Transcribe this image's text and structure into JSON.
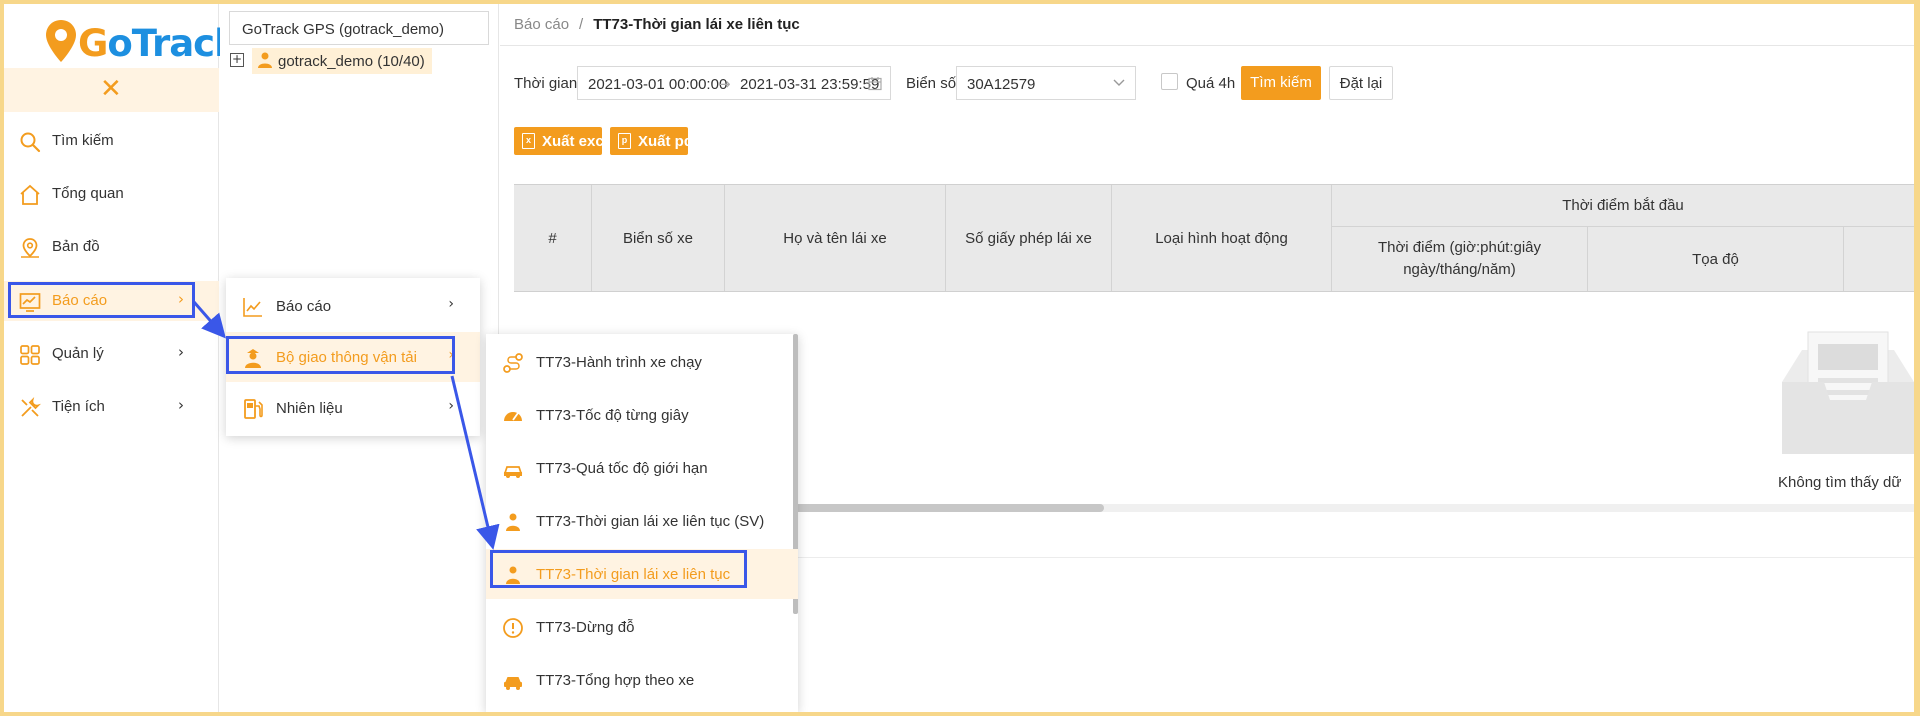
{
  "app": {
    "logo_prefix": "G",
    "logo_rest": "oTrack"
  },
  "sidebar": {
    "collapse_icon": "close-x",
    "items": [
      {
        "label": "Tìm kiếm",
        "icon": "search-icon"
      },
      {
        "label": "Tổng quan",
        "icon": "home-icon"
      },
      {
        "label": "Bản đồ",
        "icon": "map-pin-icon"
      },
      {
        "label": "Báo cáo",
        "icon": "chart-icon",
        "active": true
      },
      {
        "label": "Quản lý",
        "icon": "grid-icon"
      },
      {
        "label": "Tiện ích",
        "icon": "tools-icon"
      }
    ]
  },
  "tree": {
    "account": "GoTrack GPS (gotrack_demo)",
    "node_label": "gotrack_demo (10/40)"
  },
  "breadcrumb": {
    "root": "Báo cáo",
    "sep": "/",
    "current": "TT73-Thời gian lái xe liên tục"
  },
  "filters": {
    "time_label": "Thời gian",
    "start": "2021-03-01 00:00:00",
    "end": "2021-03-31 23:59:59",
    "plate_label": "Biển số",
    "plate_value": "30A12579",
    "over4h_label": "Quá 4h",
    "search_button": "Tìm kiếm",
    "reset_button": "Đặt lại"
  },
  "exports": {
    "excel": "Xuất excel",
    "pdf": "Xuất pdf"
  },
  "table": {
    "headers": [
      "#",
      "Biển số xe",
      "Họ và tên lái xe",
      "Số giấy phép lái xe",
      "Loại hình hoạt động"
    ],
    "group_header": "Thời điểm bắt đầu",
    "sub_headers": [
      "Thời điểm (giờ:phút:giây ngày/tháng/năm)",
      "Tọa độ"
    ],
    "empty_text": "Không tìm thấy dữ"
  },
  "menu1": {
    "items": [
      {
        "label": "Báo cáo",
        "icon": "line-chart-icon"
      },
      {
        "label": "Bộ giao thông vận tải",
        "icon": "officer-icon",
        "active": true
      },
      {
        "label": "Nhiên liệu",
        "icon": "fuel-icon"
      }
    ]
  },
  "menu2": {
    "items": [
      {
        "label": "TT73-Hành trình xe chạy",
        "icon": "route-icon"
      },
      {
        "label": "TT73-Tốc độ từng giây",
        "icon": "speedometer-icon"
      },
      {
        "label": "TT73-Quá tốc độ giới hạn",
        "icon": "car-speed-icon"
      },
      {
        "label": "TT73-Thời gian lái xe liên tục (SV)",
        "icon": "driver-icon"
      },
      {
        "label": "TT73-Thời gian lái xe liên tục",
        "icon": "driver-icon",
        "active": true
      },
      {
        "label": "TT73-Dừng đỗ",
        "icon": "alert-circle-icon"
      },
      {
        "label": "TT73-Tổng hợp theo xe",
        "icon": "car-icon"
      }
    ]
  },
  "colors": {
    "accent": "#f39c1e",
    "highlight": "#3a57e8",
    "brand_blue": "#1d8fe0"
  }
}
